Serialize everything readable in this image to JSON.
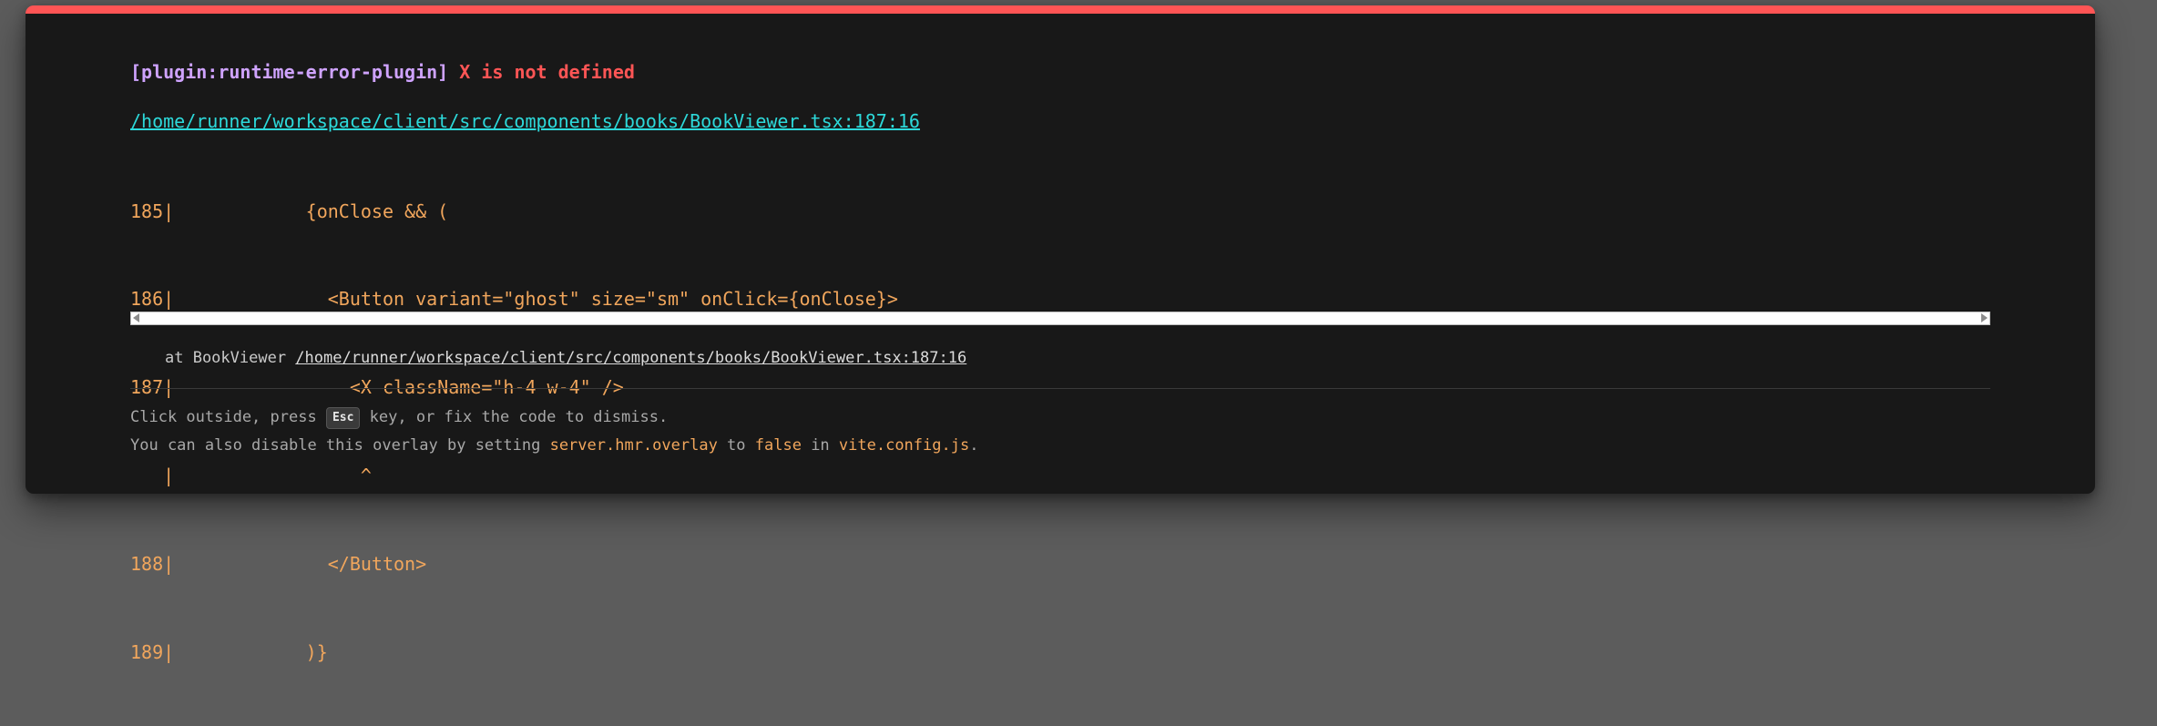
{
  "error": {
    "plugin": "[plugin:runtime-error-plugin]",
    "message": "X is not defined"
  },
  "file_link": "/home/runner/workspace/client/src/components/books/BookViewer.tsx:187:16",
  "code_frame": [
    "185|            {onClose && (",
    "186|              <Button variant=\"ghost\" size=\"sm\" onClick={onClose}>",
    "187|                <X className=\"h-4 w-4\" />",
    "   |                 ^",
    "188|              </Button>",
    "189|            )}"
  ],
  "stack": {
    "prefix": "at BookViewer ",
    "link": "/home/runner/workspace/client/src/components/books/BookViewer.tsx:187:16"
  },
  "tip": {
    "line1_a": "Click outside, press ",
    "esc_key": "Esc",
    "line1_b": " key, or fix the code to dismiss.",
    "line2_a": "You can also disable this overlay by setting ",
    "line2_code1": "server.hmr.overlay",
    "line2_b": " to ",
    "line2_code2": "false",
    "line2_c": " in ",
    "line2_code3": "vite.config.js",
    "line2_d": "."
  },
  "colors": {
    "accent_bar": "#ff5555",
    "plugin_text": "#cfa3ff",
    "error_text": "#ff5555",
    "link_text": "#2dd9da",
    "code_text": "#f1a65c",
    "panel_bg": "#181818",
    "backdrop": "#5c5c5c"
  }
}
